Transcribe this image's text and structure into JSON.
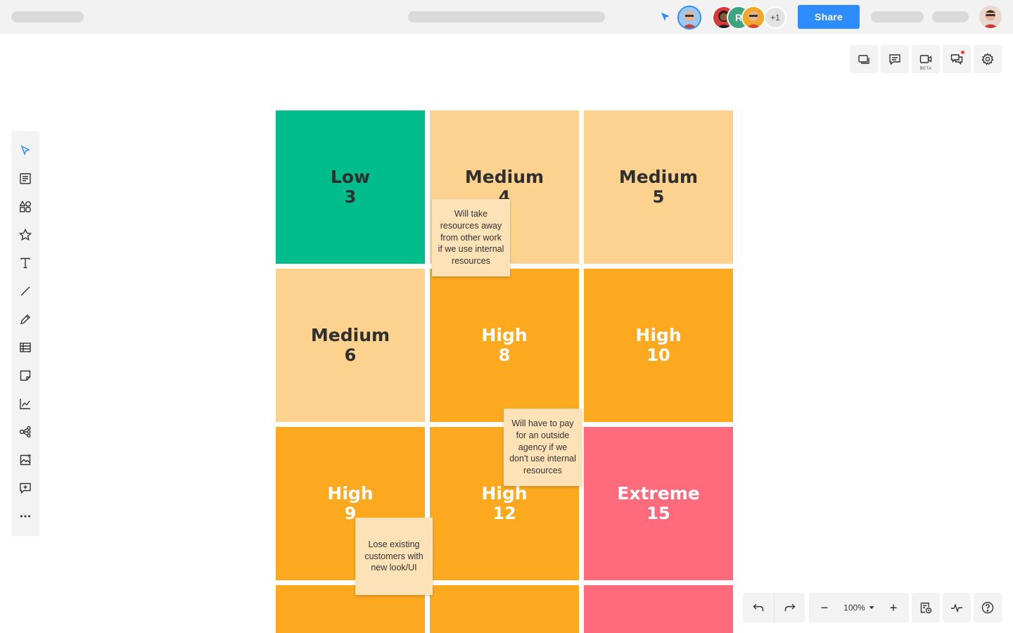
{
  "topbar": {
    "share_label": "Share",
    "collaborator_initial": "R",
    "extra_collaborators": "+1"
  },
  "right_tools": {
    "beta_label": "BETA"
  },
  "matrix": {
    "cells": [
      {
        "level": "Low",
        "score": "3",
        "color": "#00bd8b"
      },
      {
        "level": "Medium",
        "score": "4",
        "color": "#fcd28e"
      },
      {
        "level": "Medium",
        "score": "5",
        "color": "#fcd28e"
      },
      {
        "level": "Medium",
        "score": "6",
        "color": "#fcd28e"
      },
      {
        "level": "High",
        "score": "8",
        "color": "#fca91f"
      },
      {
        "level": "High",
        "score": "10",
        "color": "#fca91f"
      },
      {
        "level": "High",
        "score": "9",
        "color": "#fca91f"
      },
      {
        "level": "High",
        "score": "12",
        "color": "#fca91f"
      },
      {
        "level": "Extreme",
        "score": "15",
        "color": "#ff6b7c"
      }
    ]
  },
  "stickies": [
    {
      "text": "Will take resources away from other work if we use internal resources"
    },
    {
      "text": "Will have to pay for an outside agency if we don't use internal resources"
    },
    {
      "text": "Lose existing customers with new look/UI"
    }
  ],
  "zoom": {
    "level": "100%"
  },
  "colors": {
    "accent": "#2d8cff",
    "low": "#00bd8b",
    "medium": "#fcd28e",
    "high": "#fca91f",
    "extreme": "#ff6b7c",
    "sticky": "#fde2b8"
  }
}
